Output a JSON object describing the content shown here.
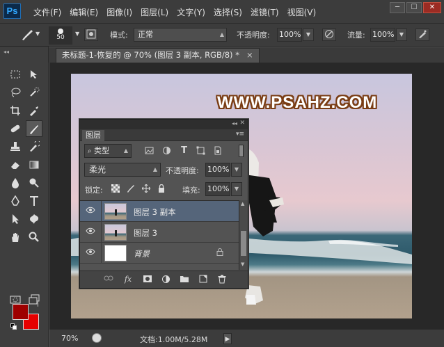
{
  "app": {
    "logo": "Ps"
  },
  "menu": [
    "文件(F)",
    "编辑(E)",
    "图像(I)",
    "图层(L)",
    "文字(Y)",
    "选择(S)",
    "滤镜(T)",
    "视图(V)"
  ],
  "window_controls": {
    "minimize": "─",
    "maximize": "☐",
    "close": "✕"
  },
  "options_bar": {
    "brush_size": "50",
    "mode_label": "模式:",
    "mode_value": "正常",
    "opacity_label": "不透明度:",
    "opacity_value": "100%",
    "flow_label": "流量:",
    "flow_value": "100%"
  },
  "document_tab": {
    "title": "未标题-1-恢复的 @ 70% (图层 3 副本, RGB/8) *",
    "close": "×"
  },
  "canvas": {
    "watermark": "WWW.PSAHZ.COM"
  },
  "status_bar": {
    "zoom": "70%",
    "doc_size": "文档:1.00M/5.28M"
  },
  "tools": [
    "marquee-icon",
    "move-icon",
    "lasso-icon",
    "quick-selection-icon",
    "crop-icon",
    "eyedropper-icon",
    "healing-brush-icon",
    "brush-icon",
    "clone-stamp-icon",
    "history-brush-icon",
    "eraser-icon",
    "gradient-icon",
    "blur-icon",
    "dodge-icon",
    "pen-icon",
    "type-icon",
    "path-selection-icon",
    "shape-icon",
    "hand-icon",
    "zoom-icon"
  ],
  "colors": {
    "foreground": "#9e0000",
    "background": "#e60000",
    "selected_layer": "#55657a"
  },
  "layers_panel": {
    "tab": "图层",
    "filter_label": "类型",
    "blend_mode": "柔光",
    "opacity_label": "不透明度:",
    "opacity_value": "100%",
    "lock_label": "锁定:",
    "fill_label": "填充:",
    "fill_value": "100%",
    "layers": [
      {
        "name": "图层 3 副本",
        "selected": true,
        "visible": true
      },
      {
        "name": "图层 3",
        "selected": false,
        "visible": true
      },
      {
        "name": "背景",
        "selected": false,
        "visible": true,
        "locked": true
      }
    ],
    "footer_icons": [
      "link-icon",
      "fx-icon",
      "mask-icon",
      "adjustment-icon",
      "group-icon",
      "new-layer-icon",
      "delete-icon"
    ],
    "fx_label": "fx"
  }
}
